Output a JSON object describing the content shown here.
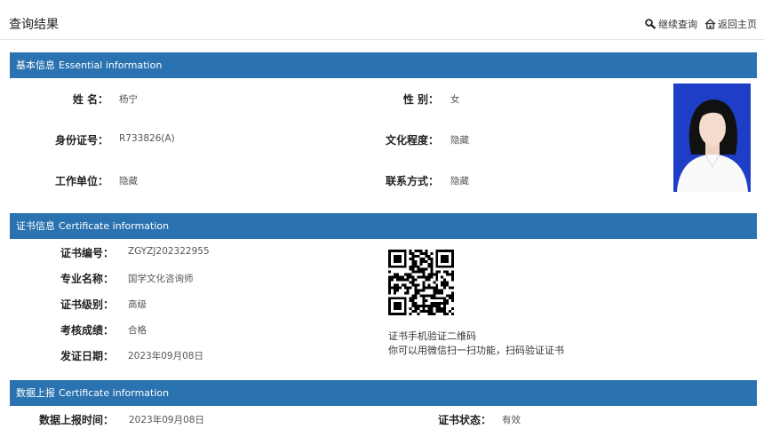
{
  "header": {
    "title": "查询结果",
    "continue_label": "继续查询",
    "home_label": "返回主页"
  },
  "basic": {
    "section_cn": "基本信息",
    "section_en": "Essential information",
    "name_label": "姓    名：",
    "name_value": "杨宁",
    "gender_label": "性    别：",
    "gender_value": "女",
    "id_label": "身份证号：",
    "id_value": "R733826(A)",
    "education_label": "文化程度：",
    "education_value": "隐藏",
    "work_label": "工作单位：",
    "work_value": "隐藏",
    "contact_label": "联系方式：",
    "contact_value": "隐藏"
  },
  "certificate": {
    "section_cn": "证书信息",
    "section_en": "Certificate information",
    "number_label": "证书编号：",
    "number_value": "ZGYZJ202322955",
    "major_label": "专业名称：",
    "major_value": "国学文化咨询师",
    "level_label": "证书级别：",
    "level_value": "高级",
    "score_label": "考核成绩：",
    "score_value": "合格",
    "date_label": "发证日期：",
    "date_value": "2023年09月08日",
    "qr_caption_1": "证书手机验证二维码",
    "qr_caption_2": "你可以用微信扫一扫功能，扫码验证证书"
  },
  "report": {
    "section_cn": "数据上报",
    "section_en": "Certificate information",
    "time_label": "数据上报时间：",
    "time_value": "2023年09月08日",
    "status_label": "证书状态：",
    "status_value": "有效"
  },
  "colors": {
    "section_bar": "#2a72b0",
    "photo_background": "#1f3ec8"
  }
}
